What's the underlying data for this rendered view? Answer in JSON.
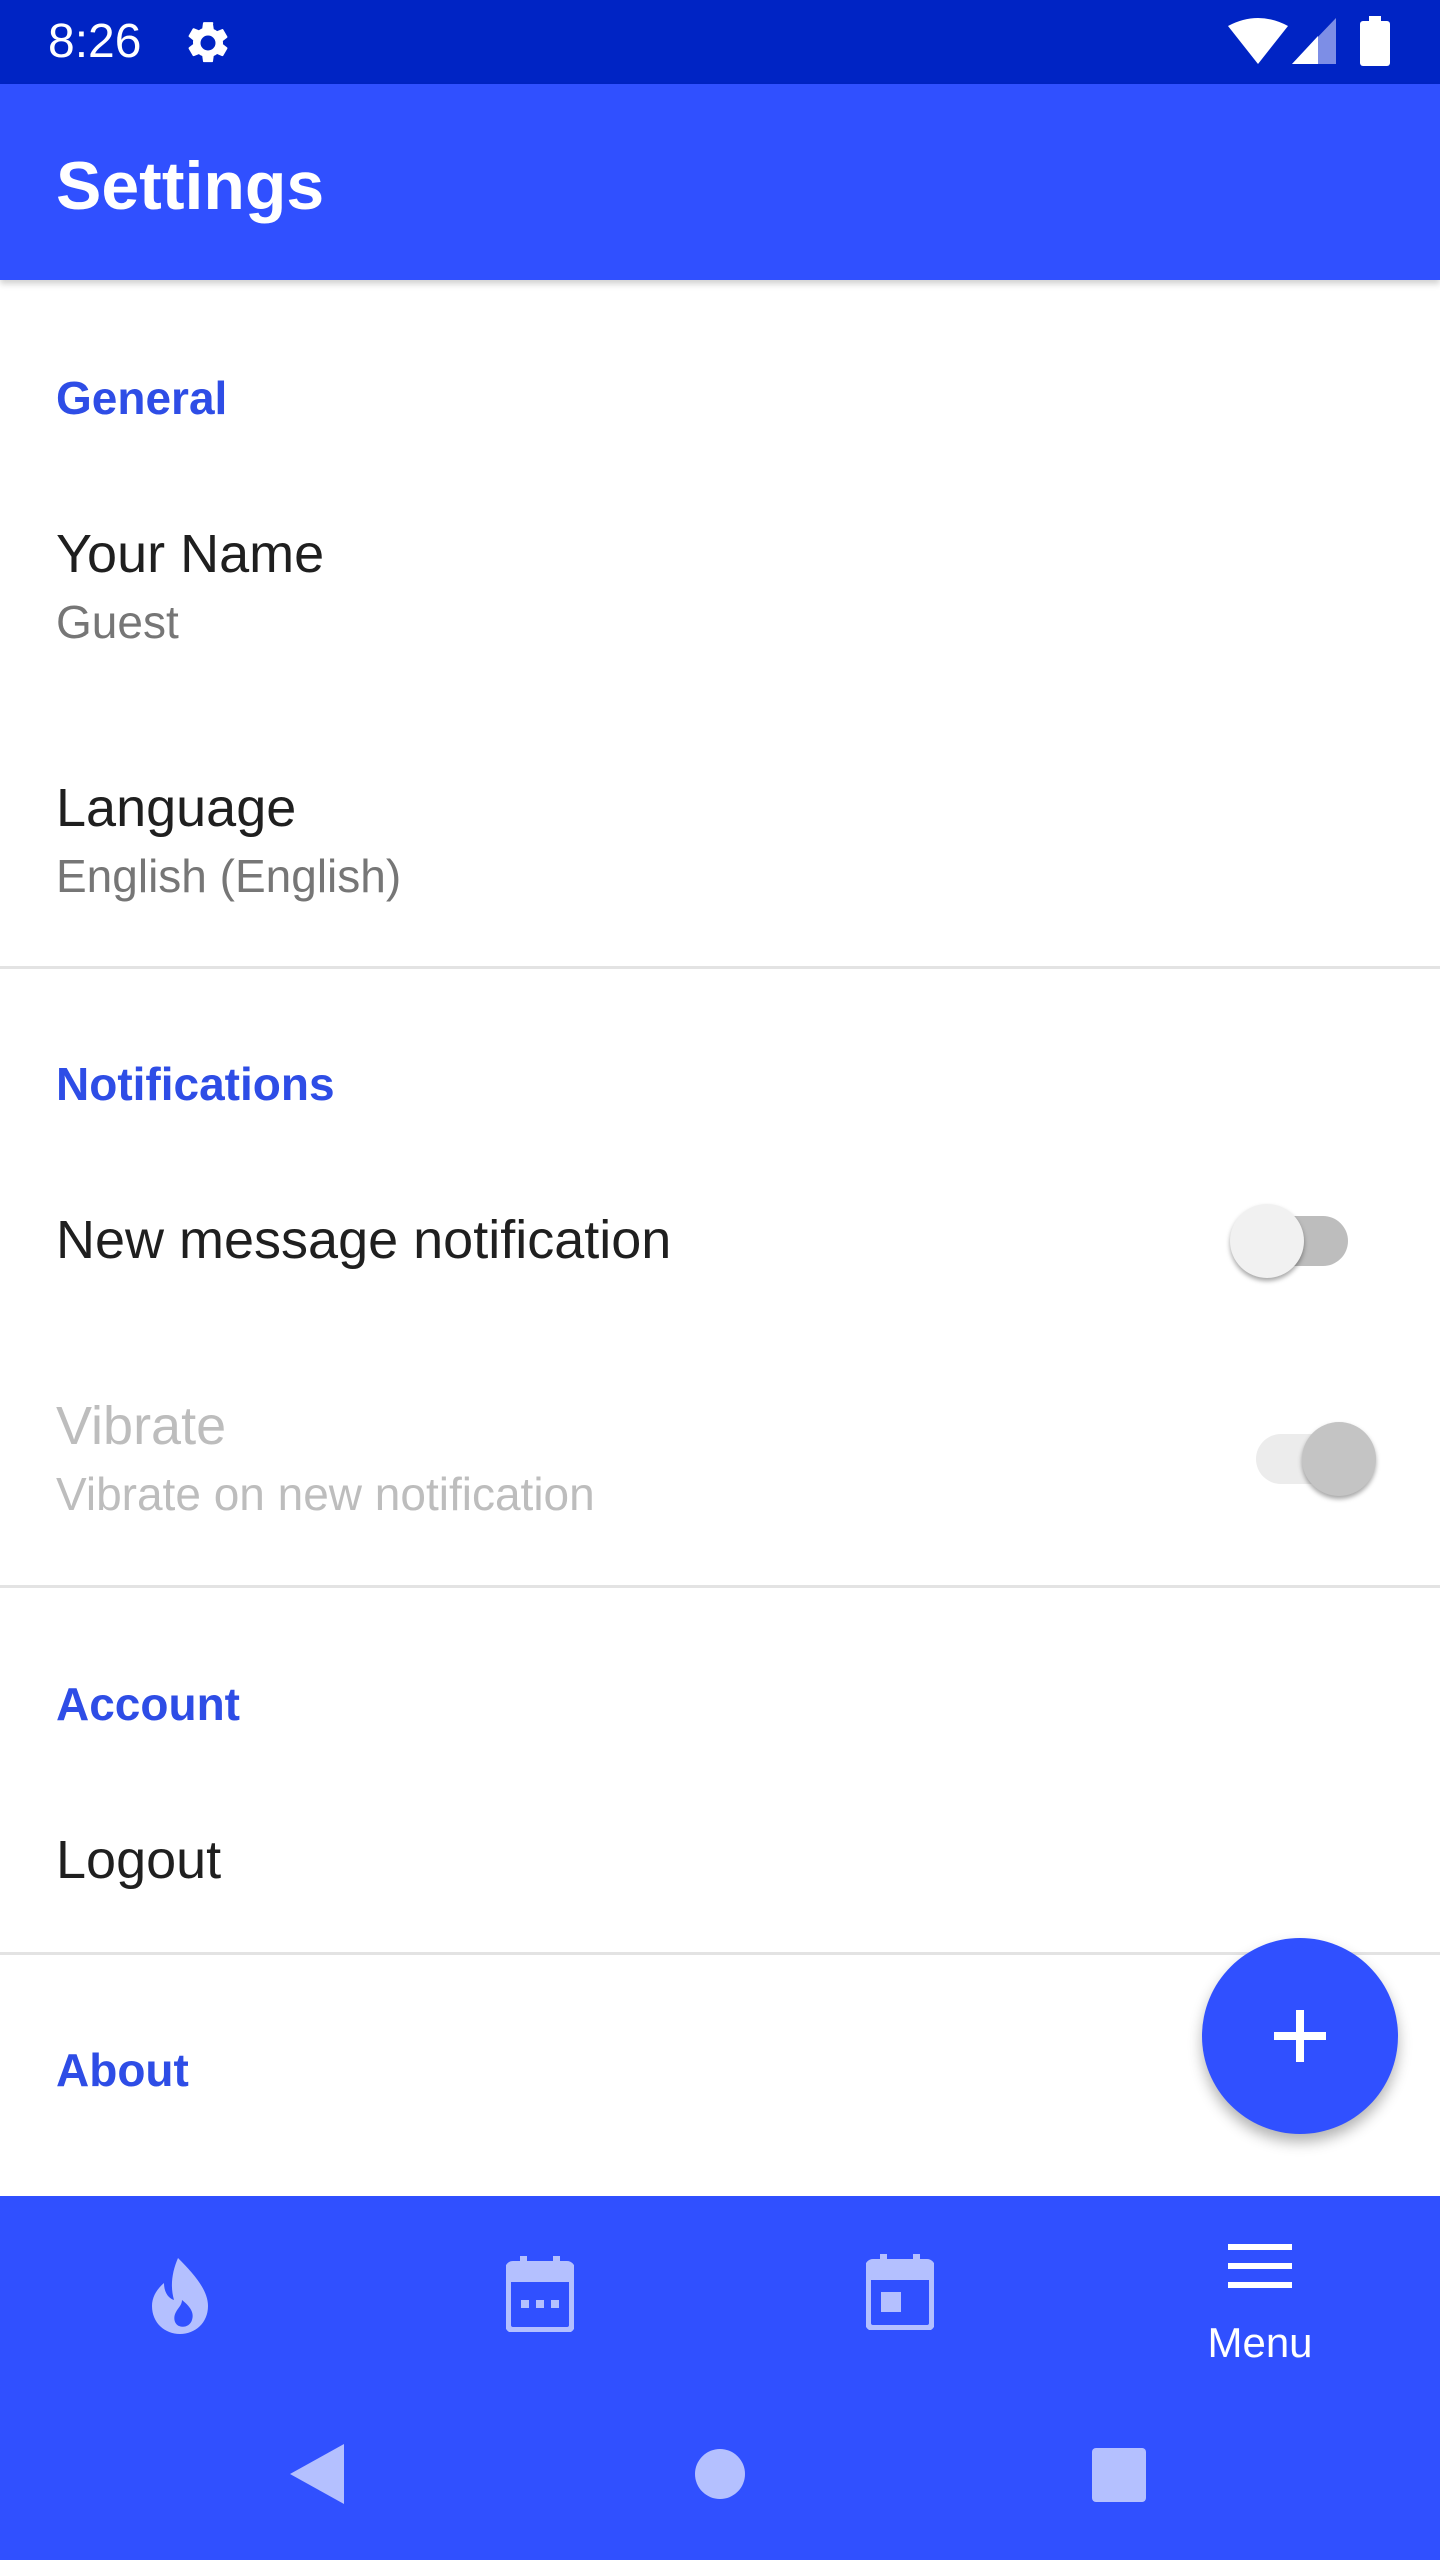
{
  "status_bar": {
    "time": "8:26",
    "icons": [
      "gear-icon",
      "wifi-icon",
      "cellular-signal-icon",
      "battery-icon"
    ]
  },
  "app_bar": {
    "title": "Settings"
  },
  "sections": {
    "general": {
      "header": "General",
      "your_name": {
        "title": "Your Name",
        "summary": "Guest"
      },
      "language": {
        "title": "Language",
        "summary": "English (English)"
      }
    },
    "notifications": {
      "header": "Notifications",
      "new_message": {
        "title": "New message notification",
        "switch_on": false
      },
      "vibrate": {
        "title": "Vibrate",
        "summary": "Vibrate on new notification",
        "switch_on": true,
        "enabled": false
      }
    },
    "account": {
      "header": "Account",
      "logout": {
        "title": "Logout"
      }
    },
    "about": {
      "header": "About"
    }
  },
  "fab": {
    "icon": "plus-icon"
  },
  "bottom_nav": {
    "items": [
      {
        "icon": "flame-icon",
        "label": ""
      },
      {
        "icon": "calendar-dots-icon",
        "label": ""
      },
      {
        "icon": "calendar-day-icon",
        "label": ""
      },
      {
        "icon": "menu-icon",
        "label": "Menu"
      }
    ]
  },
  "system_nav": {
    "buttons": [
      "back-icon",
      "home-icon",
      "recents-icon"
    ]
  },
  "colors": {
    "primary": "#3050ff",
    "status_bar": "#0024c4",
    "section_header": "#2e4de6",
    "nav_icon_inactive": "#b4c0ff"
  }
}
